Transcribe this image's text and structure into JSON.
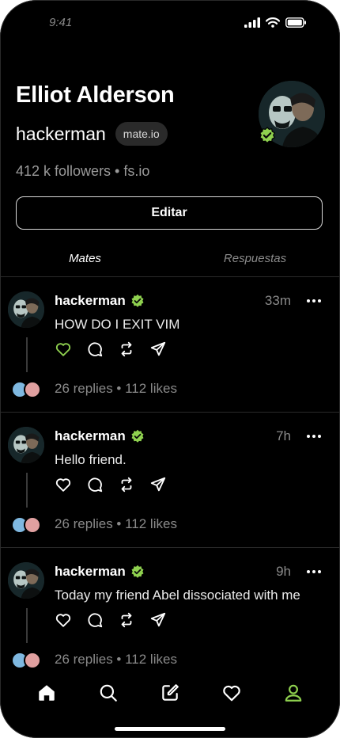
{
  "status_bar": {
    "time": "9:41",
    "icons": [
      "signal-icon",
      "wifi-icon",
      "battery-icon"
    ]
  },
  "profile": {
    "name": "Elliot Alderson",
    "handle": "hackerman",
    "domain_badge": "mate.io",
    "followers_line": "412 k followers • fs.io",
    "verified": true
  },
  "actions": {
    "edit_label": "Editar"
  },
  "tabs": [
    {
      "label": "Mates",
      "active": true
    },
    {
      "label": "Respuestas",
      "active": false
    }
  ],
  "posts": [
    {
      "user": "hackerman",
      "time": "33m",
      "text": "HOW DO I EXIT VIM",
      "liked": true,
      "stats": "26 replies • 112 likes"
    },
    {
      "user": "hackerman",
      "time": "7h",
      "text": "Hello friend.",
      "liked": false,
      "stats": "26 replies • 112 likes"
    },
    {
      "user": "hackerman",
      "time": "9h",
      "text": "Today my friend Abel dissociated with me",
      "liked": false,
      "stats": "26 replies • 112 likes"
    }
  ],
  "bottom_nav": [
    "home-icon",
    "search-icon",
    "compose-icon",
    "heart-icon",
    "profile-icon"
  ],
  "colors": {
    "background": "#000000",
    "accent_green": "#8fd14f",
    "muted_text": "#8a8a8a"
  }
}
